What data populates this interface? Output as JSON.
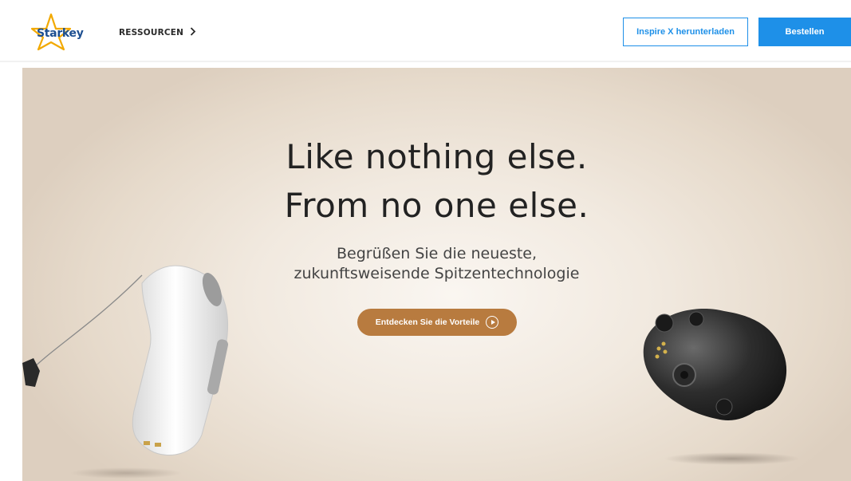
{
  "header": {
    "logo": {
      "text": "Starkey",
      "icon": "star-logo-icon"
    },
    "nav": {
      "resources_label": "RESSOURCEN",
      "resources_icon": "chevron-right-icon"
    },
    "download_button": "Inspire X herunterladen",
    "order_button": "Bestellen"
  },
  "hero": {
    "headline_line1": "Like nothing else.",
    "headline_line2": "From no one else.",
    "subtitle_line1": "Begrüßen Sie die neueste,",
    "subtitle_line2": "zukunftsweisende Spitzentechnologie",
    "cta_label": "Entdecken Sie die Vorteile",
    "cta_icon": "play-circle-icon",
    "left_image": "hearing-aid-ric-image",
    "right_image": "hearing-aid-itc-image"
  },
  "colors": {
    "brand_blue": "#1e90e8",
    "logo_blue": "#1d4f91",
    "logo_star": "#f2a900",
    "cta_copper": "#b87b3f",
    "hero_beige": "#efe6db"
  }
}
